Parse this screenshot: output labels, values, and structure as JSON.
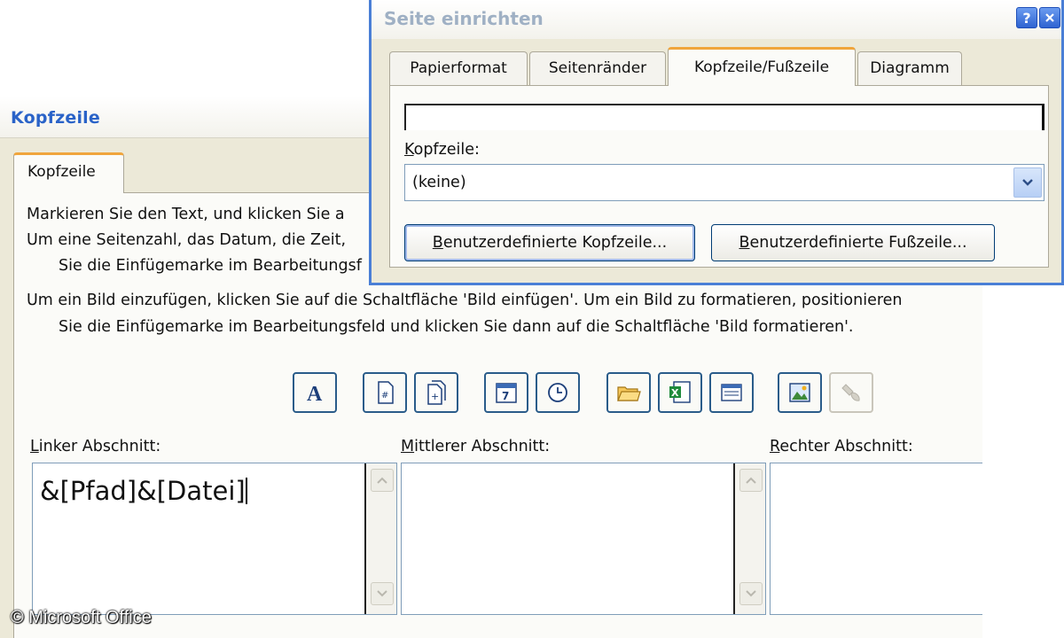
{
  "kopfzeile_dialog": {
    "title": "Kopfzeile",
    "tab_label": "Kopfzeile",
    "instructions": [
      "Markieren Sie den Text, und klicken Sie a",
      "Um eine Seitenzahl, das Datum, die Zeit,",
      "Sie die Einfügemarke im Bearbeitungsf",
      "Um ein Bild einzufügen, klicken Sie auf die Schaltfläche 'Bild einfügen'. Um ein Bild zu formatieren, positionieren",
      "Sie die Einfügemarke im Bearbeitungsfeld und klicken Sie dann auf die Schaltfläche 'Bild formatieren'."
    ],
    "toolbar": [
      {
        "icon": "font-icon"
      },
      {
        "icon": "page-number-icon"
      },
      {
        "icon": "page-count-icon"
      },
      {
        "icon": "date-icon"
      },
      {
        "icon": "time-icon"
      },
      {
        "icon": "file-path-icon"
      },
      {
        "icon": "file-name-icon"
      },
      {
        "icon": "sheet-name-icon"
      },
      {
        "icon": "insert-picture-icon"
      },
      {
        "icon": "format-picture-icon",
        "disabled": true
      }
    ],
    "sections": {
      "left": {
        "label": "Linker Abschnitt:",
        "value": "&[Pfad]&[Datei]"
      },
      "center": {
        "label": "Mittlerer Abschnitt:",
        "value": ""
      },
      "right": {
        "label": "Rechter Abschnitt:",
        "value": ""
      }
    }
  },
  "seite_einrichten_dialog": {
    "title": "Seite einrichten",
    "tabs": [
      {
        "label": "Papierformat"
      },
      {
        "label": "Seitenränder"
      },
      {
        "label": "Kopfzeile/Fußzeile",
        "active": true
      },
      {
        "label": "Diagramm"
      }
    ],
    "kopfzeile_label": "Kopfzeile:",
    "kopfzeile_value": "(keine)",
    "custom_header_button": "Benutzerdefinierte Kopfzeile...",
    "custom_footer_button": "Benutzerdefinierte Fußzeile..."
  },
  "copyright": "© Microsoft Office",
  "colors": {
    "title_blue": "#2a63c8",
    "dialog_bg": "#ece9d8",
    "tab_accent": "#f0a53c",
    "frame_blue": "#4a7fd6"
  }
}
